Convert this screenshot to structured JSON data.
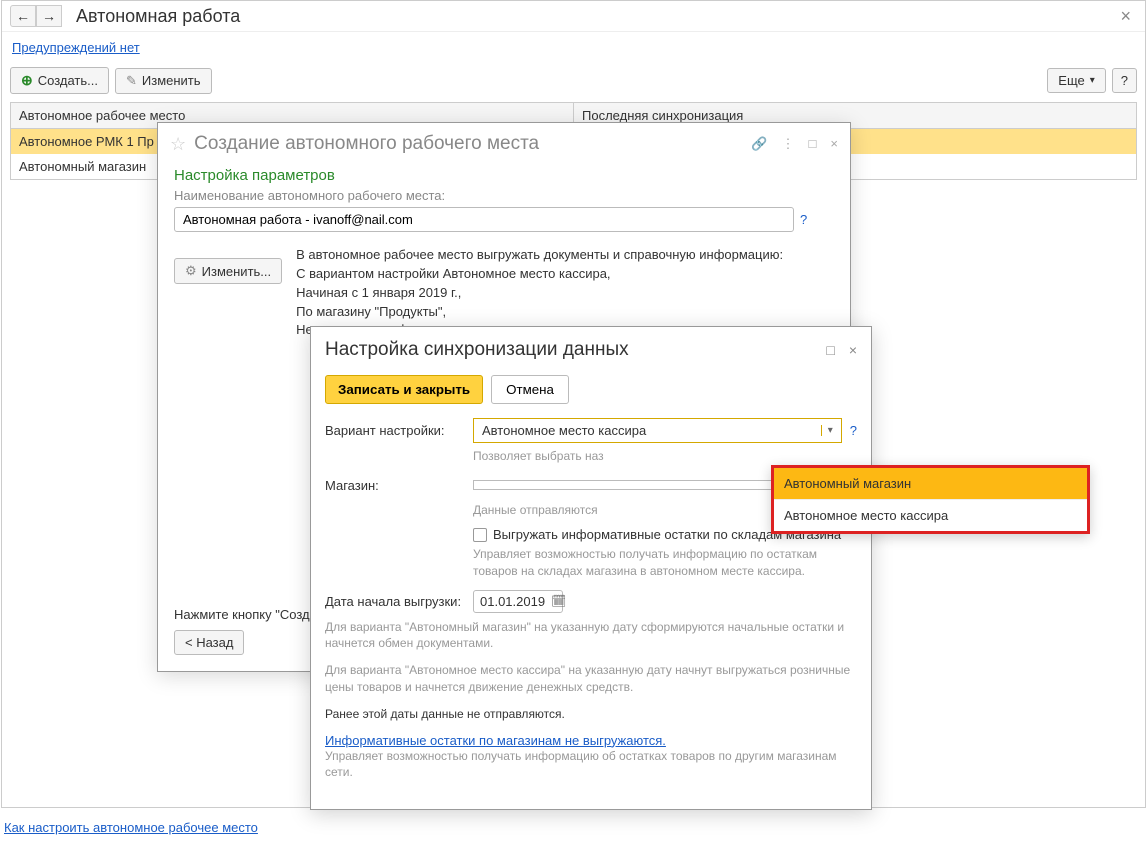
{
  "main": {
    "title": "Автономная работа",
    "warn_link": "Предупреждений нет",
    "footer_link": "Как настроить автономное рабочее место"
  },
  "toolbar": {
    "create": "Создать...",
    "edit": "Изменить",
    "more": "Еще"
  },
  "table": {
    "col1": "Автономное рабочее место",
    "col2": "Последняя синхронизация",
    "rows": [
      {
        "name": "Автономное РМК 1 Пр"
      },
      {
        "name": "Автономный магазин"
      }
    ]
  },
  "dialog1": {
    "title": "Создание автономного рабочего места",
    "section": "Настройка параметров",
    "name_label": "Наименование автономного рабочего места:",
    "name_value": "Автономная работа - ivanoff@nail.com",
    "change_btn": "Изменить...",
    "desc1": "В автономное рабочее место выгружать документы и справочную информацию:",
    "desc2": "С вариантом настройки Автономное место кассира,",
    "desc3": "Начиная с 1 января 2019 г.,",
    "desc4": "По магазину \"Продукты\",",
    "desc5": "Не выгружать информативные остатки товаров.",
    "footer_text": "Нажмите кнопку \"Созда",
    "back_btn": "< Назад"
  },
  "dialog2": {
    "title": "Настройка синхронизации данных",
    "save_btn": "Записать и закрыть",
    "cancel_btn": "Отмена",
    "variant_label": "Вариант настройки:",
    "variant_value": "Автономное место кассира",
    "variant_hint": "Позволяет выбрать наз",
    "shop_label": "Магазин:",
    "shop_hint": "Данные отправляются",
    "check_label": "Выгружать информативные остатки по складам магазина",
    "check_desc": "Управляет возможностью получать информацию по остаткам товаров на складах магазина в автономном месте кассира.",
    "date_label": "Дата начала выгрузки:",
    "date_value": "01.01.2019",
    "date_desc1": "Для варианта \"Автономный магазин\" на указанную дату сформируются начальные остатки и начнется обмен документами.",
    "date_desc2": "Для варианта \"Автономное место кассира\" на указанную дату начнут выгружаться розничные цены товаров и начнется движение денежных средств.",
    "date_desc3": "Ранее этой даты данные не отправляются.",
    "link": "Информативные остатки по магазинам не выгружаются.",
    "link_desc": "Управляет возможностью получать информацию об остатках товаров по другим магазинам сети."
  },
  "dropdown": {
    "opt1": "Автономный магазин",
    "opt2": "Автономное место кассира"
  }
}
